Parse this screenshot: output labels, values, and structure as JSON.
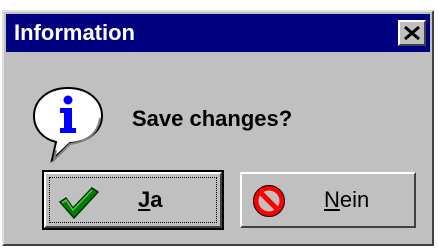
{
  "dialog": {
    "title": "Information",
    "message": "Save changes?",
    "icon": "info-icon",
    "close_icon": "close-icon"
  },
  "buttons": {
    "yes": {
      "mnemonic": "J",
      "rest": "a",
      "icon": "checkmark-icon"
    },
    "no": {
      "mnemonic": "N",
      "rest": "ein",
      "icon": "no-symbol-icon"
    }
  },
  "colors": {
    "titlebar": "#000080",
    "face": "#c0c0c0",
    "check": "#008000",
    "no_symbol": "#ff0000",
    "info_letter": "#0000ff"
  }
}
